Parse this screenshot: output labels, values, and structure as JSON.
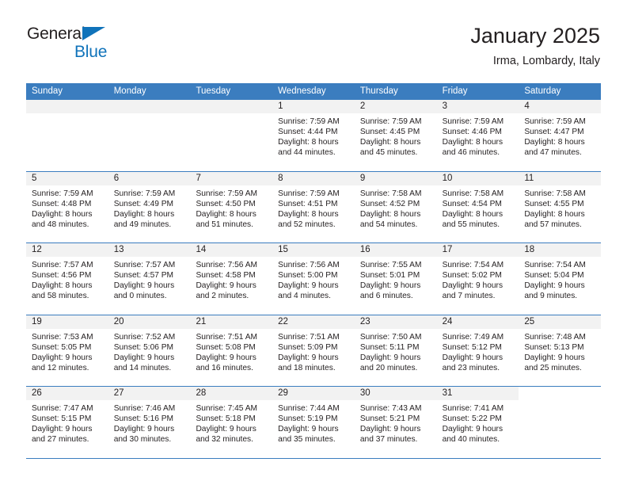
{
  "brand": {
    "name_top": "General",
    "name_bottom": "Blue",
    "accent_color": "#1073ba"
  },
  "header": {
    "title": "January 2025",
    "subtitle": "Irma, Lombardy, Italy"
  },
  "calendar": {
    "header_color": "#3b7dbf",
    "daynum_band_color": "#f2f2f2",
    "weekdays": [
      "Sunday",
      "Monday",
      "Tuesday",
      "Wednesday",
      "Thursday",
      "Friday",
      "Saturday"
    ],
    "weeks": [
      [
        {
          "day": "",
          "lines": []
        },
        {
          "day": "",
          "lines": []
        },
        {
          "day": "",
          "lines": []
        },
        {
          "day": "1",
          "lines": [
            "Sunrise: 7:59 AM",
            "Sunset: 4:44 PM",
            "Daylight: 8 hours",
            "and 44 minutes."
          ]
        },
        {
          "day": "2",
          "lines": [
            "Sunrise: 7:59 AM",
            "Sunset: 4:45 PM",
            "Daylight: 8 hours",
            "and 45 minutes."
          ]
        },
        {
          "day": "3",
          "lines": [
            "Sunrise: 7:59 AM",
            "Sunset: 4:46 PM",
            "Daylight: 8 hours",
            "and 46 minutes."
          ]
        },
        {
          "day": "4",
          "lines": [
            "Sunrise: 7:59 AM",
            "Sunset: 4:47 PM",
            "Daylight: 8 hours",
            "and 47 minutes."
          ]
        }
      ],
      [
        {
          "day": "5",
          "lines": [
            "Sunrise: 7:59 AM",
            "Sunset: 4:48 PM",
            "Daylight: 8 hours",
            "and 48 minutes."
          ]
        },
        {
          "day": "6",
          "lines": [
            "Sunrise: 7:59 AM",
            "Sunset: 4:49 PM",
            "Daylight: 8 hours",
            "and 49 minutes."
          ]
        },
        {
          "day": "7",
          "lines": [
            "Sunrise: 7:59 AM",
            "Sunset: 4:50 PM",
            "Daylight: 8 hours",
            "and 51 minutes."
          ]
        },
        {
          "day": "8",
          "lines": [
            "Sunrise: 7:59 AM",
            "Sunset: 4:51 PM",
            "Daylight: 8 hours",
            "and 52 minutes."
          ]
        },
        {
          "day": "9",
          "lines": [
            "Sunrise: 7:58 AM",
            "Sunset: 4:52 PM",
            "Daylight: 8 hours",
            "and 54 minutes."
          ]
        },
        {
          "day": "10",
          "lines": [
            "Sunrise: 7:58 AM",
            "Sunset: 4:54 PM",
            "Daylight: 8 hours",
            "and 55 minutes."
          ]
        },
        {
          "day": "11",
          "lines": [
            "Sunrise: 7:58 AM",
            "Sunset: 4:55 PM",
            "Daylight: 8 hours",
            "and 57 minutes."
          ]
        }
      ],
      [
        {
          "day": "12",
          "lines": [
            "Sunrise: 7:57 AM",
            "Sunset: 4:56 PM",
            "Daylight: 8 hours",
            "and 58 minutes."
          ]
        },
        {
          "day": "13",
          "lines": [
            "Sunrise: 7:57 AM",
            "Sunset: 4:57 PM",
            "Daylight: 9 hours",
            "and 0 minutes."
          ]
        },
        {
          "day": "14",
          "lines": [
            "Sunrise: 7:56 AM",
            "Sunset: 4:58 PM",
            "Daylight: 9 hours",
            "and 2 minutes."
          ]
        },
        {
          "day": "15",
          "lines": [
            "Sunrise: 7:56 AM",
            "Sunset: 5:00 PM",
            "Daylight: 9 hours",
            "and 4 minutes."
          ]
        },
        {
          "day": "16",
          "lines": [
            "Sunrise: 7:55 AM",
            "Sunset: 5:01 PM",
            "Daylight: 9 hours",
            "and 6 minutes."
          ]
        },
        {
          "day": "17",
          "lines": [
            "Sunrise: 7:54 AM",
            "Sunset: 5:02 PM",
            "Daylight: 9 hours",
            "and 7 minutes."
          ]
        },
        {
          "day": "18",
          "lines": [
            "Sunrise: 7:54 AM",
            "Sunset: 5:04 PM",
            "Daylight: 9 hours",
            "and 9 minutes."
          ]
        }
      ],
      [
        {
          "day": "19",
          "lines": [
            "Sunrise: 7:53 AM",
            "Sunset: 5:05 PM",
            "Daylight: 9 hours",
            "and 12 minutes."
          ]
        },
        {
          "day": "20",
          "lines": [
            "Sunrise: 7:52 AM",
            "Sunset: 5:06 PM",
            "Daylight: 9 hours",
            "and 14 minutes."
          ]
        },
        {
          "day": "21",
          "lines": [
            "Sunrise: 7:51 AM",
            "Sunset: 5:08 PM",
            "Daylight: 9 hours",
            "and 16 minutes."
          ]
        },
        {
          "day": "22",
          "lines": [
            "Sunrise: 7:51 AM",
            "Sunset: 5:09 PM",
            "Daylight: 9 hours",
            "and 18 minutes."
          ]
        },
        {
          "day": "23",
          "lines": [
            "Sunrise: 7:50 AM",
            "Sunset: 5:11 PM",
            "Daylight: 9 hours",
            "and 20 minutes."
          ]
        },
        {
          "day": "24",
          "lines": [
            "Sunrise: 7:49 AM",
            "Sunset: 5:12 PM",
            "Daylight: 9 hours",
            "and 23 minutes."
          ]
        },
        {
          "day": "25",
          "lines": [
            "Sunrise: 7:48 AM",
            "Sunset: 5:13 PM",
            "Daylight: 9 hours",
            "and 25 minutes."
          ]
        }
      ],
      [
        {
          "day": "26",
          "lines": [
            "Sunrise: 7:47 AM",
            "Sunset: 5:15 PM",
            "Daylight: 9 hours",
            "and 27 minutes."
          ]
        },
        {
          "day": "27",
          "lines": [
            "Sunrise: 7:46 AM",
            "Sunset: 5:16 PM",
            "Daylight: 9 hours",
            "and 30 minutes."
          ]
        },
        {
          "day": "28",
          "lines": [
            "Sunrise: 7:45 AM",
            "Sunset: 5:18 PM",
            "Daylight: 9 hours",
            "and 32 minutes."
          ]
        },
        {
          "day": "29",
          "lines": [
            "Sunrise: 7:44 AM",
            "Sunset: 5:19 PM",
            "Daylight: 9 hours",
            "and 35 minutes."
          ]
        },
        {
          "day": "30",
          "lines": [
            "Sunrise: 7:43 AM",
            "Sunset: 5:21 PM",
            "Daylight: 9 hours",
            "and 37 minutes."
          ]
        },
        {
          "day": "31",
          "lines": [
            "Sunrise: 7:41 AM",
            "Sunset: 5:22 PM",
            "Daylight: 9 hours",
            "and 40 minutes."
          ]
        },
        {
          "day": "",
          "lines": []
        }
      ]
    ]
  }
}
